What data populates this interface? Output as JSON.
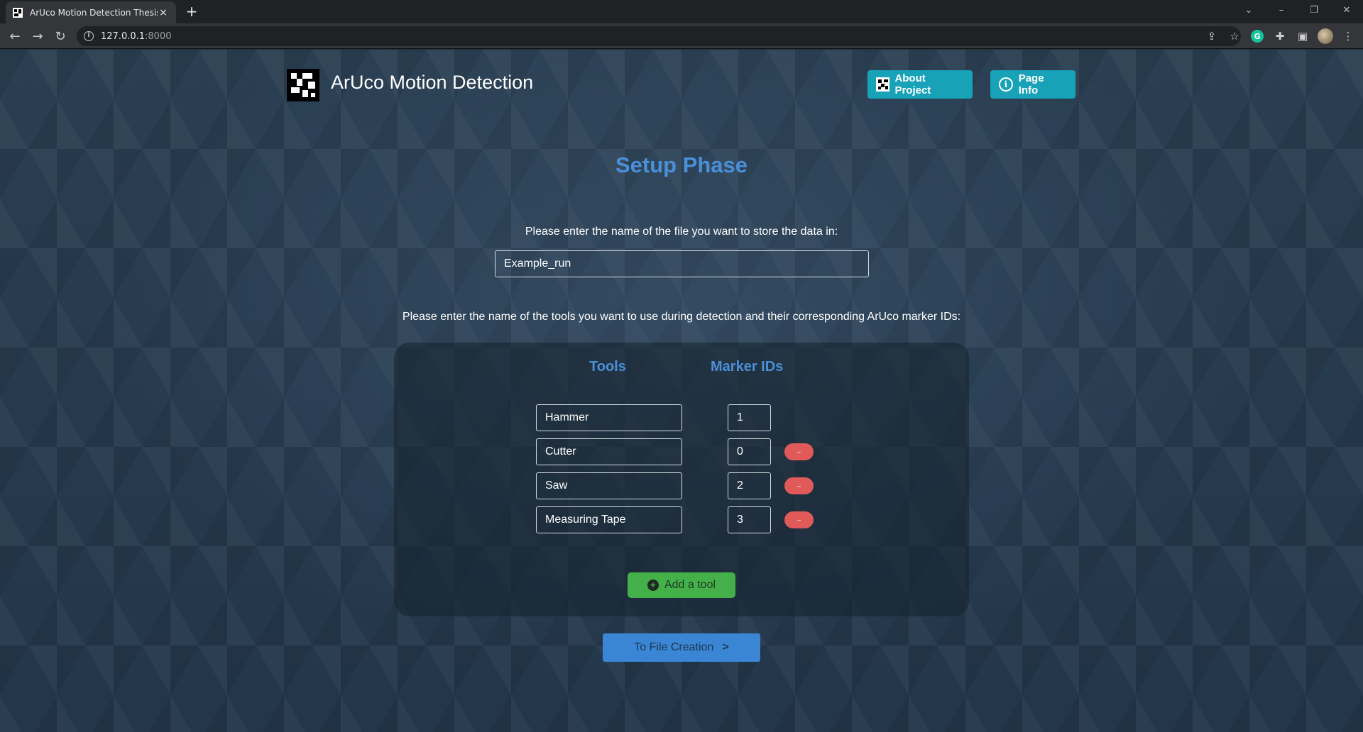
{
  "browser": {
    "tab_title": "ArUco Motion Detection Thesis",
    "tab_close": "×",
    "new_tab": "+",
    "url_host": "127.0.0.1",
    "url_port": ":8000",
    "window_controls": {
      "chevron": "⌄",
      "minimize": "–",
      "restore": "❐",
      "close": "✕"
    },
    "grammarly_letter": "G"
  },
  "header": {
    "brand_title": "ArUco Motion Detection",
    "about_label": "About Project",
    "info_label": "Page Info"
  },
  "main": {
    "title": "Setup Phase",
    "file_prompt": "Please enter the name of the file you want to store the data in:",
    "file_name_value": "Example_run",
    "tools_prompt": "Please enter the name of the tools you want to use during detection and their corresponding ArUco marker IDs:",
    "col_tools": "Tools",
    "col_marker_ids": "Marker IDs",
    "tools": [
      {
        "name": "Hammer",
        "id": "1",
        "removable": false
      },
      {
        "name": "Cutter",
        "id": "0",
        "removable": true
      },
      {
        "name": "Saw",
        "id": "2",
        "removable": true
      },
      {
        "name": "Measuring Tape",
        "id": "3",
        "removable": true
      }
    ],
    "remove_label": "–",
    "add_tool_label": "Add a tool",
    "next_label": "To File Creation",
    "next_chevron": ">"
  },
  "colors": {
    "accent_blue": "#4a90d9",
    "info_button": "#17a2b8",
    "add_button": "#44b049",
    "remove_button": "#e05a5a",
    "next_button": "#3a86d4"
  }
}
